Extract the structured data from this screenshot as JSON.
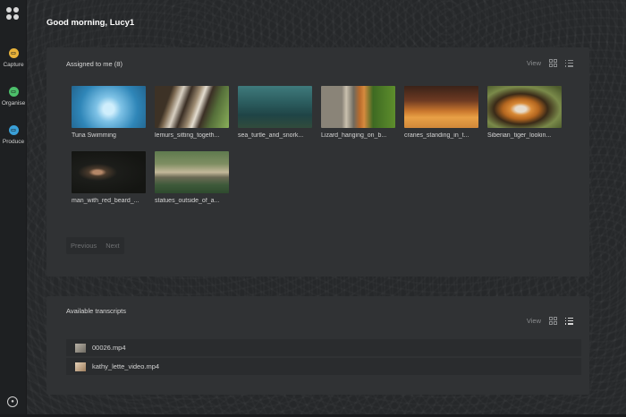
{
  "greeting": "Good morning, Lucy1",
  "sidebar": {
    "items": [
      {
        "label": "Capture",
        "icon": "capture-icon",
        "color": "#e8b23a"
      },
      {
        "label": "Organise",
        "icon": "organise-icon",
        "color": "#4cbf6a"
      },
      {
        "label": "Produce",
        "icon": "produce-icon",
        "color": "#3aa0d8"
      }
    ]
  },
  "assigned": {
    "title": "Assigned to me (8)",
    "view_label": "View",
    "items": [
      {
        "label": "Tuna Swimming",
        "thumb": "underwater-blue"
      },
      {
        "label": "lemurs_sitting_togeth...",
        "thumb": "lemurs-forest"
      },
      {
        "label": "sea_turtle_and_snork...",
        "thumb": "sea-turtle-teal"
      },
      {
        "label": "Lizard_hanging_on_b...",
        "thumb": "lizard-branch"
      },
      {
        "label": "cranes_standing_in_t...",
        "thumb": "cranes-sunset"
      },
      {
        "label": "Siberian_tiger_lookin...",
        "thumb": "tiger-portrait"
      },
      {
        "label": "man_with_red_beard_...",
        "thumb": "man-dark-scene"
      },
      {
        "label": "statues_outside_of_a...",
        "thumb": "temple-statues"
      }
    ],
    "pager": {
      "previous": "Previous",
      "next": "Next"
    }
  },
  "transcripts": {
    "title": "Available transcripts",
    "view_label": "View",
    "files": [
      {
        "name": "00026.mp4"
      },
      {
        "name": "kathy_lette_video.mp4"
      }
    ]
  }
}
